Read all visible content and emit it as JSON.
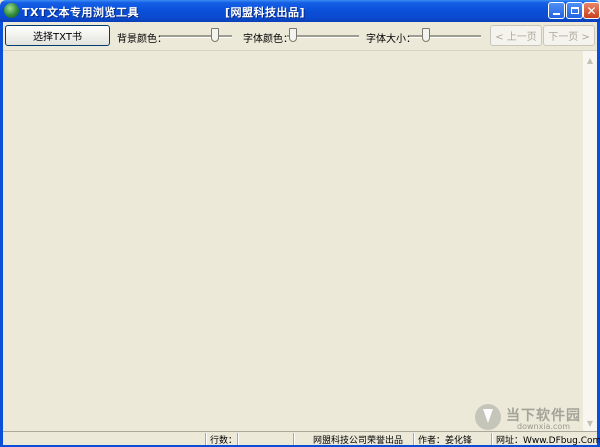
{
  "window": {
    "title": "TXT文本专用浏览工具",
    "subtitle": "[网盟科技出品]",
    "minimize_icon": "minimize-icon",
    "maximize_icon": "maximize-icon",
    "close_glyph": "✕"
  },
  "toolbar": {
    "choose_button": "选择TXT书",
    "bg_color_label": "背景颜色：",
    "font_color_label": "字体颜色：",
    "font_size_label": "字体大小：",
    "prev_button": "< 上一页",
    "next_button": "下一页 >"
  },
  "content": {
    "scroll_up": "▲",
    "scroll_down": "▼"
  },
  "statusbar": {
    "line_count_label": "行数：",
    "company": "网盟科技公司荣誉出品",
    "author": "作者：姜化锋",
    "website": "网址：Www.DFbug.Com"
  },
  "watermark": {
    "main": "当下软件园",
    "sub": "downxia.com"
  },
  "colors": {
    "titlebar": "#0a4fd8",
    "face": "#ece9d8",
    "close_button": "#c9401c"
  }
}
